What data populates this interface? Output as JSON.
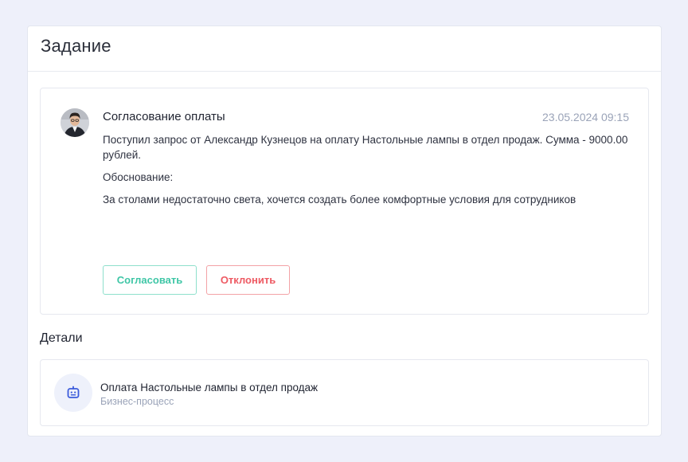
{
  "page": {
    "title": "Задание"
  },
  "task": {
    "title": "Согласование оплаты",
    "date": "23.05.2024 09:15",
    "message": "Поступил запрос от Александр Кузнецов на оплату Настольные лампы в отдел продаж. Сумма - 9000.00 рублей.",
    "reason_label": "Обоснование:",
    "reason_text": "За столами недостаточно света, хочется создать более комфортные условия для сотрудников",
    "approve_label": "Согласовать",
    "reject_label": "Отклонить"
  },
  "details": {
    "title": "Детали",
    "item_name": "Оплата Настольные лампы в отдел продаж",
    "item_type": "Бизнес-процесс",
    "icon": "robot-icon"
  },
  "colors": {
    "background": "#eef0fa",
    "approve": "#3fc6a6",
    "reject": "#ee5a63",
    "accent": "#3b5bdb",
    "muted": "#9aa3b8"
  }
}
